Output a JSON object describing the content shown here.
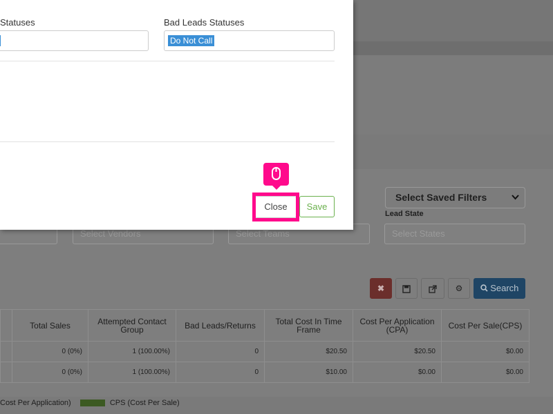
{
  "modal": {
    "good_statuses_label": "Statuses",
    "bad_statuses_label": "Bad Leads Statuses",
    "bad_statuses_chip": "Do Not Call",
    "close_label": "Close",
    "save_label": "Save"
  },
  "filters": {
    "saved_filters_label": "Select Saved Filters",
    "lead_state_label": "Lead State",
    "vendors_placeholder": "Select Vendors",
    "teams_placeholder": "Select Teams",
    "states_placeholder": "Select States",
    "search_label": "Search"
  },
  "table": {
    "headers": [
      "Total Sales",
      "Attempted Contact Group",
      "Bad Leads/Returns",
      "Total Cost In Time Frame",
      "Cost Per Application (CPA)",
      "Cost Per Sale(CPS)"
    ],
    "rows": [
      [
        "0 (0%)",
        "1 (100.00%)",
        "0",
        "$20.50",
        "$20.50",
        "$0.00"
      ],
      [
        "0 (0%)",
        "1 (100.00%)",
        "0",
        "$10.00",
        "$0.00",
        "$0.00"
      ]
    ]
  },
  "legend": {
    "cpa_text": "Cost Per Application)",
    "cps_text": "CPS (Cost Per Sale)"
  },
  "colors": {
    "highlight": "#ff0a8c",
    "save_green": "#6ab04c",
    "chip_blue": "#3a8fd6",
    "search_blue": "#337ab7",
    "danger_red": "#d9534f"
  }
}
